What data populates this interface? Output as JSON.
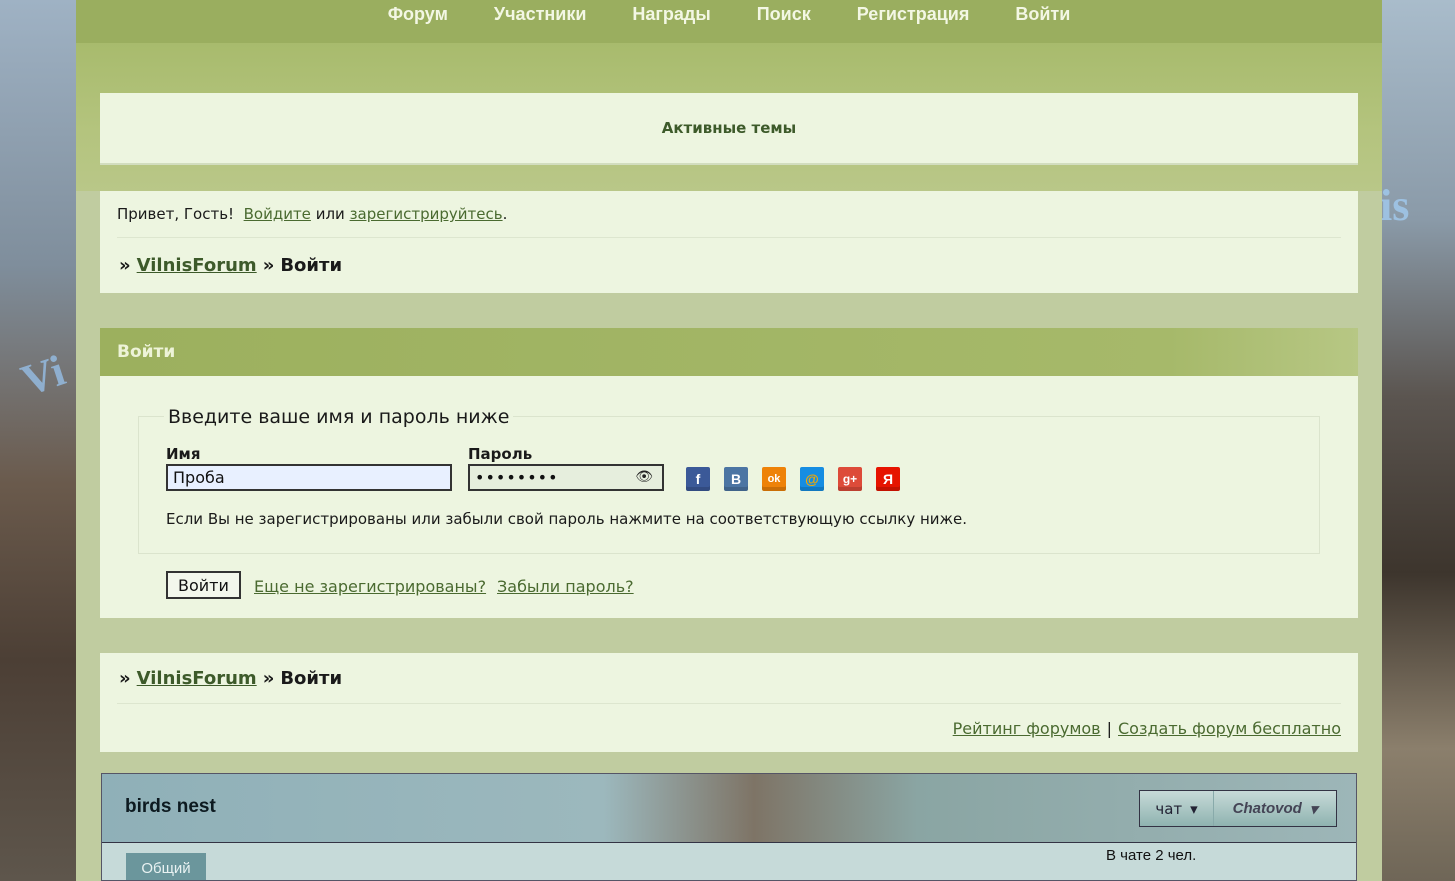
{
  "nav": [
    "Форум",
    "Участники",
    "Награды",
    "Поиск",
    "Регистрация",
    "Войти"
  ],
  "active_topics": "Активные темы",
  "greeting": {
    "prefix": "Привет, Гость!",
    "login_link": "Войдите",
    "or": "или",
    "register_link": "зарегистрируйтесь",
    "period": "."
  },
  "breadcrumb": {
    "sep": "»",
    "forum": "VilnisForum",
    "current": "Войти"
  },
  "login": {
    "header": "Войти",
    "legend": "Введите ваше имя и пароль ниже",
    "name_label": "Имя",
    "name_value": "Проба",
    "password_label": "Пароль",
    "password_value": "••••••••",
    "hint": "Если Вы не зарегистрированы или забыли свой пароль нажмите на соответствующую ссылку ниже.",
    "submit": "Войти",
    "not_registered": "Еще не зарегистрированы?",
    "forgot": "Забыли пароль?"
  },
  "social": [
    {
      "icon": "facebook-icon",
      "glyph": "f",
      "color": "#3b5998"
    },
    {
      "icon": "vkontakte-icon",
      "glyph": "B",
      "color": "#4c75a3"
    },
    {
      "icon": "odnoklassniki-icon",
      "glyph": "ok",
      "color": "#ee8208"
    },
    {
      "icon": "mailru-icon",
      "glyph": "@",
      "color": "#168de2"
    },
    {
      "icon": "googleplus-icon",
      "glyph": "g+",
      "color": "#dd4b39"
    },
    {
      "icon": "yandex-icon",
      "glyph": "Я",
      "color": "#e61400"
    }
  ],
  "footer": {
    "rating": "Рейтинг форумов",
    "sep": "|",
    "create": "Создать форум бесплатно"
  },
  "chat": {
    "title": "birds nest",
    "chat_btn": "чат",
    "brand": "Chatovod",
    "tab": "Общий",
    "count": "В чате 2 чел."
  }
}
